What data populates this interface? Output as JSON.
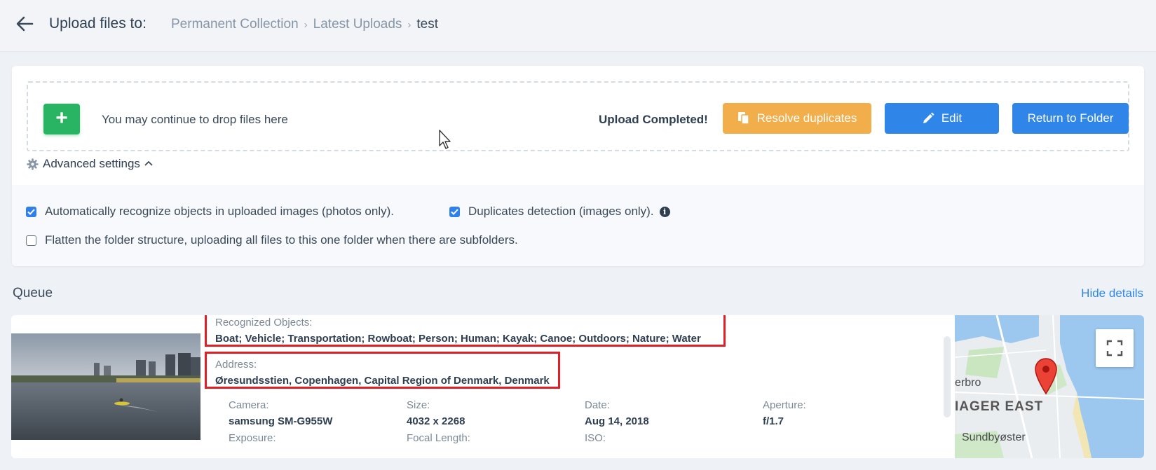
{
  "header": {
    "title": "Upload files to:",
    "breadcrumb": [
      "Permanent Collection",
      "Latest Uploads",
      "test"
    ]
  },
  "dropzone": {
    "text": "You may continue to drop files here",
    "status": "Upload Completed!"
  },
  "actions": {
    "resolve": "Resolve duplicates",
    "edit": "Edit",
    "return": "Return to Folder"
  },
  "advanced": {
    "label": "Advanced settings",
    "options": [
      {
        "label": "Automatically recognize objects in uploaded images (photos only).",
        "checked": true
      },
      {
        "label": "Duplicates detection (images only).",
        "checked": true
      },
      {
        "label": "Flatten the folder structure, uploading all files to this one folder when there are subfolders.",
        "checked": false
      }
    ]
  },
  "queue": {
    "title": "Queue",
    "hide_details": "Hide details",
    "item": {
      "recognized_label": "Recognized Objects:",
      "recognized_value": "Boat; Vehicle; Transportation; Rowboat; Person; Human; Kayak; Canoe; Outdoors; Nature; Water",
      "address_label": "Address:",
      "address_value": "Øresundsstien, Copenhagen, Capital Region of Denmark, Denmark",
      "camera_label": "Camera:",
      "camera_value": "samsung SM-G955W",
      "size_label": "Size:",
      "size_value": "4032 x 2268",
      "date_label": "Date:",
      "date_value": "Aug 14, 2018",
      "aperture_label": "Aperture:",
      "aperture_value": "f/1.7",
      "exposure_label": "Exposure:",
      "focal_label": "Focal Length:",
      "iso_label": "ISO:"
    },
    "map": {
      "label1": "erbro",
      "label2": "IAGER EAST",
      "label3": "Sundbyøster"
    }
  },
  "colors": {
    "primary": "#2f86e8",
    "success": "#28b462",
    "warning": "#f2ae4a",
    "highlight": "#e31e24"
  }
}
